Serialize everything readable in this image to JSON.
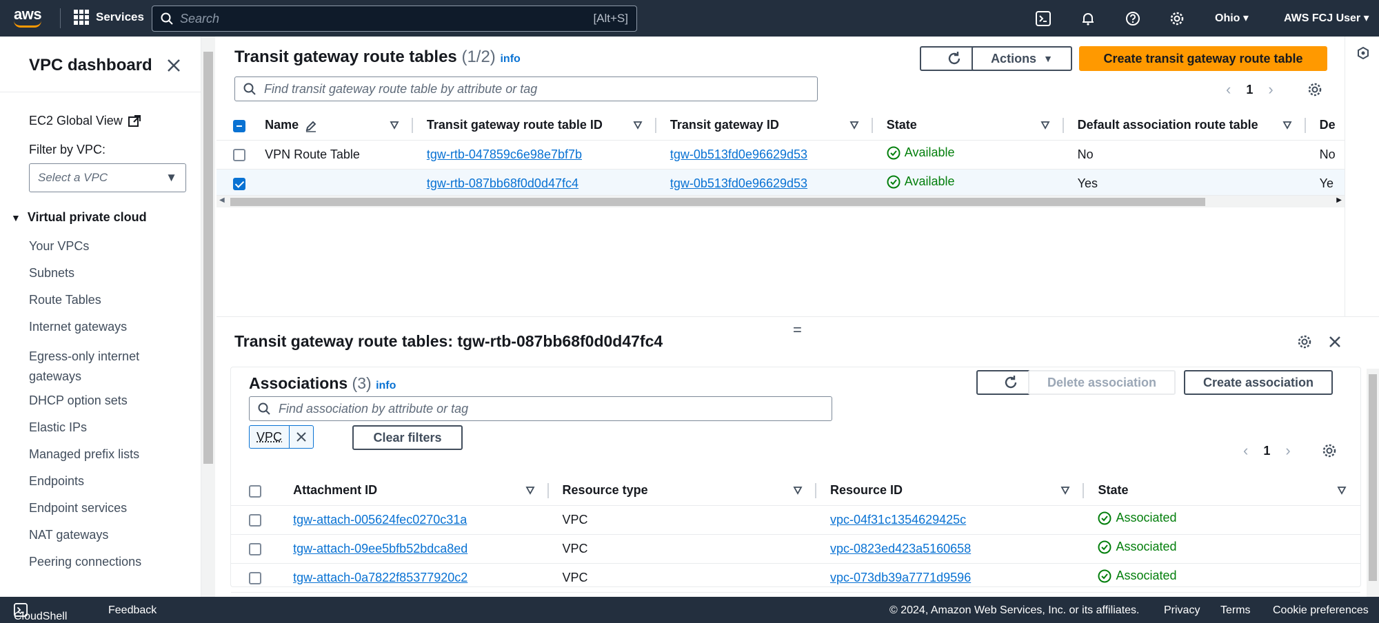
{
  "topbar": {
    "logo_text": "aws",
    "services_label": "Services",
    "search_placeholder": "Search",
    "search_shortcut": "[Alt+S]",
    "region": "Ohio",
    "user": "AWS FCJ User"
  },
  "sidenav": {
    "title": "VPC dashboard",
    "ec2_global_view": "EC2 Global View",
    "filter_label": "Filter by VPC:",
    "vpc_select_placeholder": "Select a VPC",
    "section_label": "Virtual private cloud",
    "items": [
      {
        "label": "Your VPCs"
      },
      {
        "label": "Subnets"
      },
      {
        "label": "Route Tables"
      },
      {
        "label": "Internet gateways"
      },
      {
        "label": "Egress-only internet gateways"
      },
      {
        "label": "DHCP option sets"
      },
      {
        "label": "Elastic IPs"
      },
      {
        "label": "Managed prefix lists"
      },
      {
        "label": "Endpoints"
      },
      {
        "label": "Endpoint services"
      },
      {
        "label": "NAT gateways"
      },
      {
        "label": "Peering connections"
      }
    ]
  },
  "main": {
    "title": "Transit gateway route tables",
    "count": "(1/2)",
    "info": "info",
    "actions_label": "Actions",
    "create_label": "Create transit gateway route table",
    "filter_placeholder": "Find transit gateway route table by attribute or tag",
    "page": "1",
    "columns": [
      "Name",
      "Transit gateway route table ID",
      "Transit gateway ID",
      "State",
      "Default association route table",
      "De"
    ],
    "rows": [
      {
        "name": "VPN Route Table",
        "rtb_id": "tgw-rtb-047859c6e98e7bf7b",
        "tgw_id": "tgw-0b513fd0e96629d53",
        "state": "Available",
        "default_assoc": "No",
        "trunc": "No",
        "selected": false
      },
      {
        "name": "",
        "rtb_id": "tgw-rtb-087bb68f0d0d47fc4",
        "tgw_id": "tgw-0b513fd0e96629d53",
        "state": "Available",
        "default_assoc": "Yes",
        "trunc": "Ye",
        "selected": true
      }
    ]
  },
  "split": {
    "title": "Transit gateway route tables: tgw-rtb-087bb68f0d0d47fc4",
    "grip": "=",
    "assoc_title": "Associations",
    "assoc_count": "(3)",
    "info": "info",
    "delete_label": "Delete association",
    "create_label": "Create association",
    "filter_placeholder": "Find association by attribute or tag",
    "token_label": "VPC",
    "clear_filters": "Clear filters",
    "page": "1",
    "columns": [
      "Attachment ID",
      "Resource type",
      "Resource ID",
      "State"
    ],
    "rows": [
      {
        "attachment": "tgw-attach-005624fec0270c31a",
        "type": "VPC",
        "resource": "vpc-04f31c1354629425c",
        "state": "Associated"
      },
      {
        "attachment": "tgw-attach-09ee5bfb52bdca8ed",
        "type": "VPC",
        "resource": "vpc-0823ed423a5160658",
        "state": "Associated"
      },
      {
        "attachment": "tgw-attach-0a7822f85377920c2",
        "type": "VPC",
        "resource": "vpc-073db39a7771d9596",
        "state": "Associated"
      }
    ]
  },
  "footer": {
    "cloudshell": "CloudShell",
    "feedback": "Feedback",
    "copyright": "© 2024, Amazon Web Services, Inc. or its affiliates.",
    "privacy": "Privacy",
    "terms": "Terms",
    "cookies": "Cookie preferences"
  },
  "colors": {
    "topbar": "#232f3e",
    "primary": "#ff9900",
    "link": "#0972d3",
    "success": "#037f0c"
  }
}
